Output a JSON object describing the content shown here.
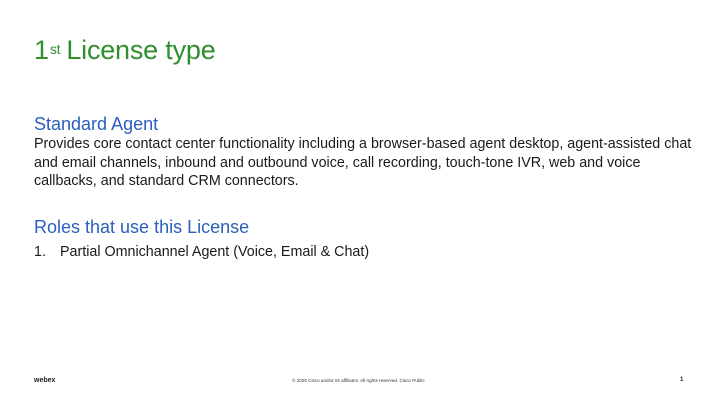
{
  "slide": {
    "title_number": "1",
    "title_superscript": "st",
    "title_label": "License type",
    "section_heading": "Standard Agent",
    "description": "Provides core contact center functionality including a browser-based agent desktop, agent-assisted chat and email channels, inbound and outbound voice, call recording, touch-tone IVR, web and voice callbacks, and standard CRM connectors.",
    "roles_heading": "Roles that use this License",
    "roles": [
      {
        "marker": "1.",
        "text": "Partial Omnichannel Agent (Voice, Email & Chat)"
      }
    ]
  },
  "footer": {
    "logo_text": "webex",
    "copyright": "© 2025 Cisco and/or its affiliates. All rights reserved. Cisco Public",
    "page_number": "1"
  },
  "colors": {
    "title": "#2f8f2f",
    "heading": "#2b5fbd",
    "body_text": "#1a1a1a",
    "background": "#ffffff"
  }
}
